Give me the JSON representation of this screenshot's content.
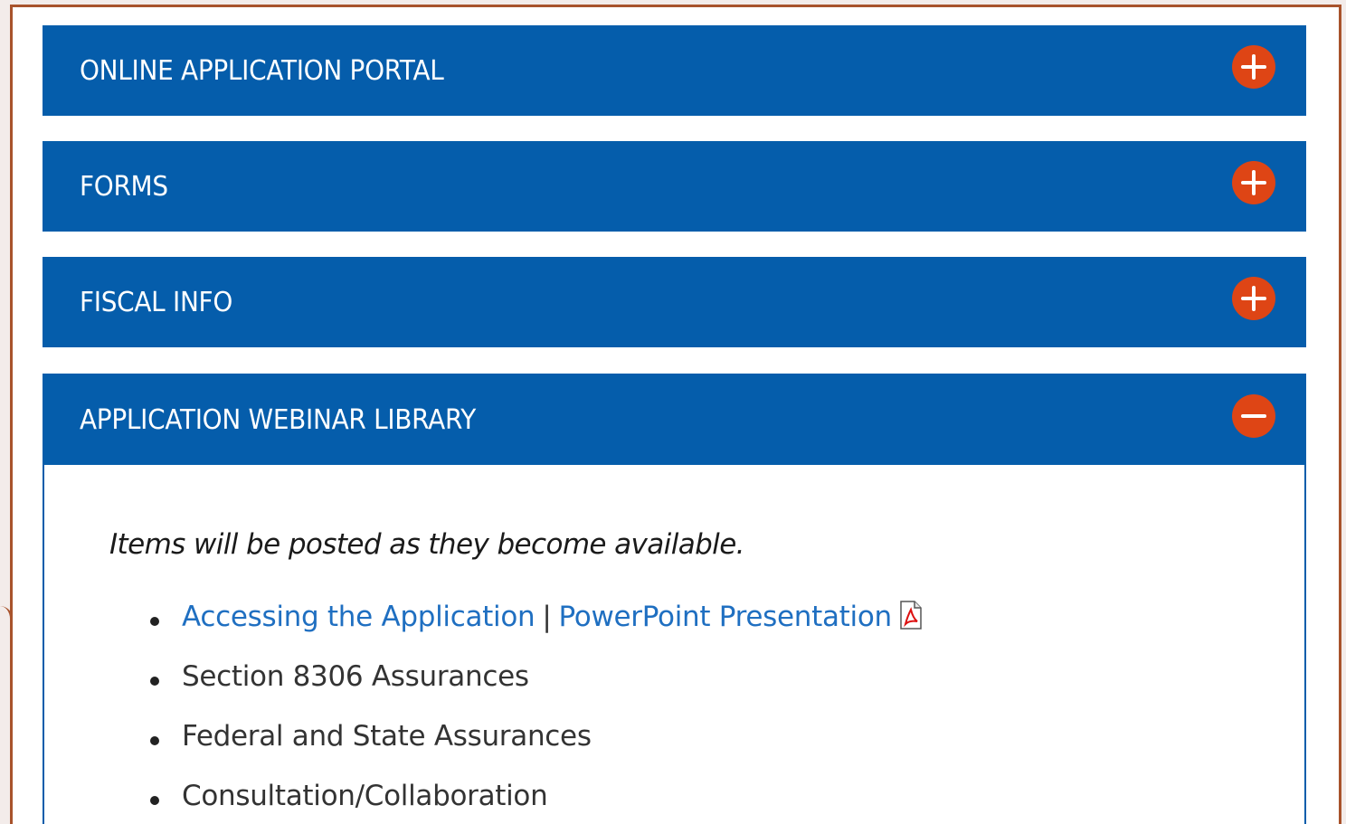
{
  "accordion": [
    {
      "title": "ONLINE APPLICATION PORTAL",
      "state": "collapsed",
      "icon": "plus-icon"
    },
    {
      "title": "FORMS",
      "state": "collapsed",
      "icon": "plus-icon"
    },
    {
      "title": "FISCAL INFO",
      "state": "collapsed",
      "icon": "plus-icon"
    },
    {
      "title": "APPLICATION WEBINAR LIBRARY",
      "state": "expanded",
      "icon": "minus-icon"
    }
  ],
  "webinar_panel": {
    "note": "Items will be posted as they become available.",
    "items": [
      {
        "link1": "Accessing the Application",
        "separator": "|",
        "link2": "PowerPoint Presentation",
        "icon": "pdf-icon"
      },
      {
        "text": "Section 8306 Assurances"
      },
      {
        "text": "Federal and State Assurances"
      },
      {
        "text": "Consultation/Collaboration"
      }
    ]
  },
  "colors": {
    "header_bg": "#055dab",
    "toggle_bg": "#de4515",
    "link": "#1f6fc1",
    "frame_border": "#a8532c"
  }
}
